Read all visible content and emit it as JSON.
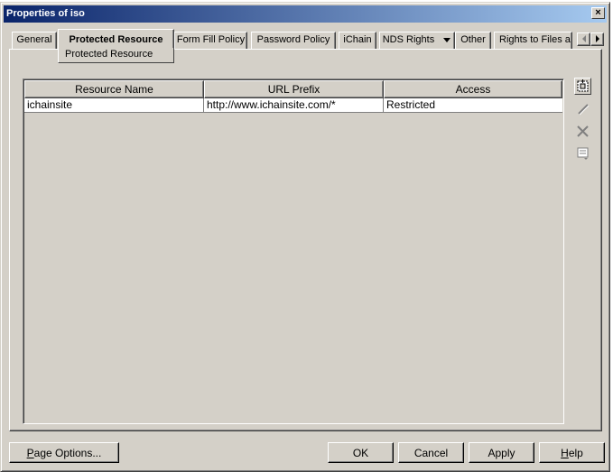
{
  "window": {
    "title": "Properties of iso",
    "close_glyph": "×"
  },
  "tabs": [
    {
      "label": "General"
    },
    {
      "label": "Protected Resource",
      "active": true
    },
    {
      "label": "Form Fill Policy"
    },
    {
      "label": "Password Policy"
    },
    {
      "label": "iChain"
    },
    {
      "label": "NDS Rights"
    },
    {
      "label": "Other"
    },
    {
      "label": "Rights to Files a"
    }
  ],
  "tab_submenu": {
    "label": "Protected Resource"
  },
  "table": {
    "columns": [
      "Resource Name",
      "URL Prefix",
      "Access"
    ],
    "rows": [
      [
        "ichainsite",
        "http://www.ichainsite.com/*",
        "Restricted"
      ]
    ]
  },
  "side_buttons": [
    "new-icon",
    "edit-icon",
    "delete-icon",
    "properties-icon"
  ],
  "footer": {
    "page_options_mnemonic": "P",
    "page_options_rest": "age Options...",
    "ok": "OK",
    "cancel": "Cancel",
    "apply": "Apply",
    "help_mnemonic": "H",
    "help_rest": "elp"
  },
  "colors": {
    "face": "#d4d0c8",
    "title_start": "#0a246a",
    "title_end": "#a6caf0"
  }
}
